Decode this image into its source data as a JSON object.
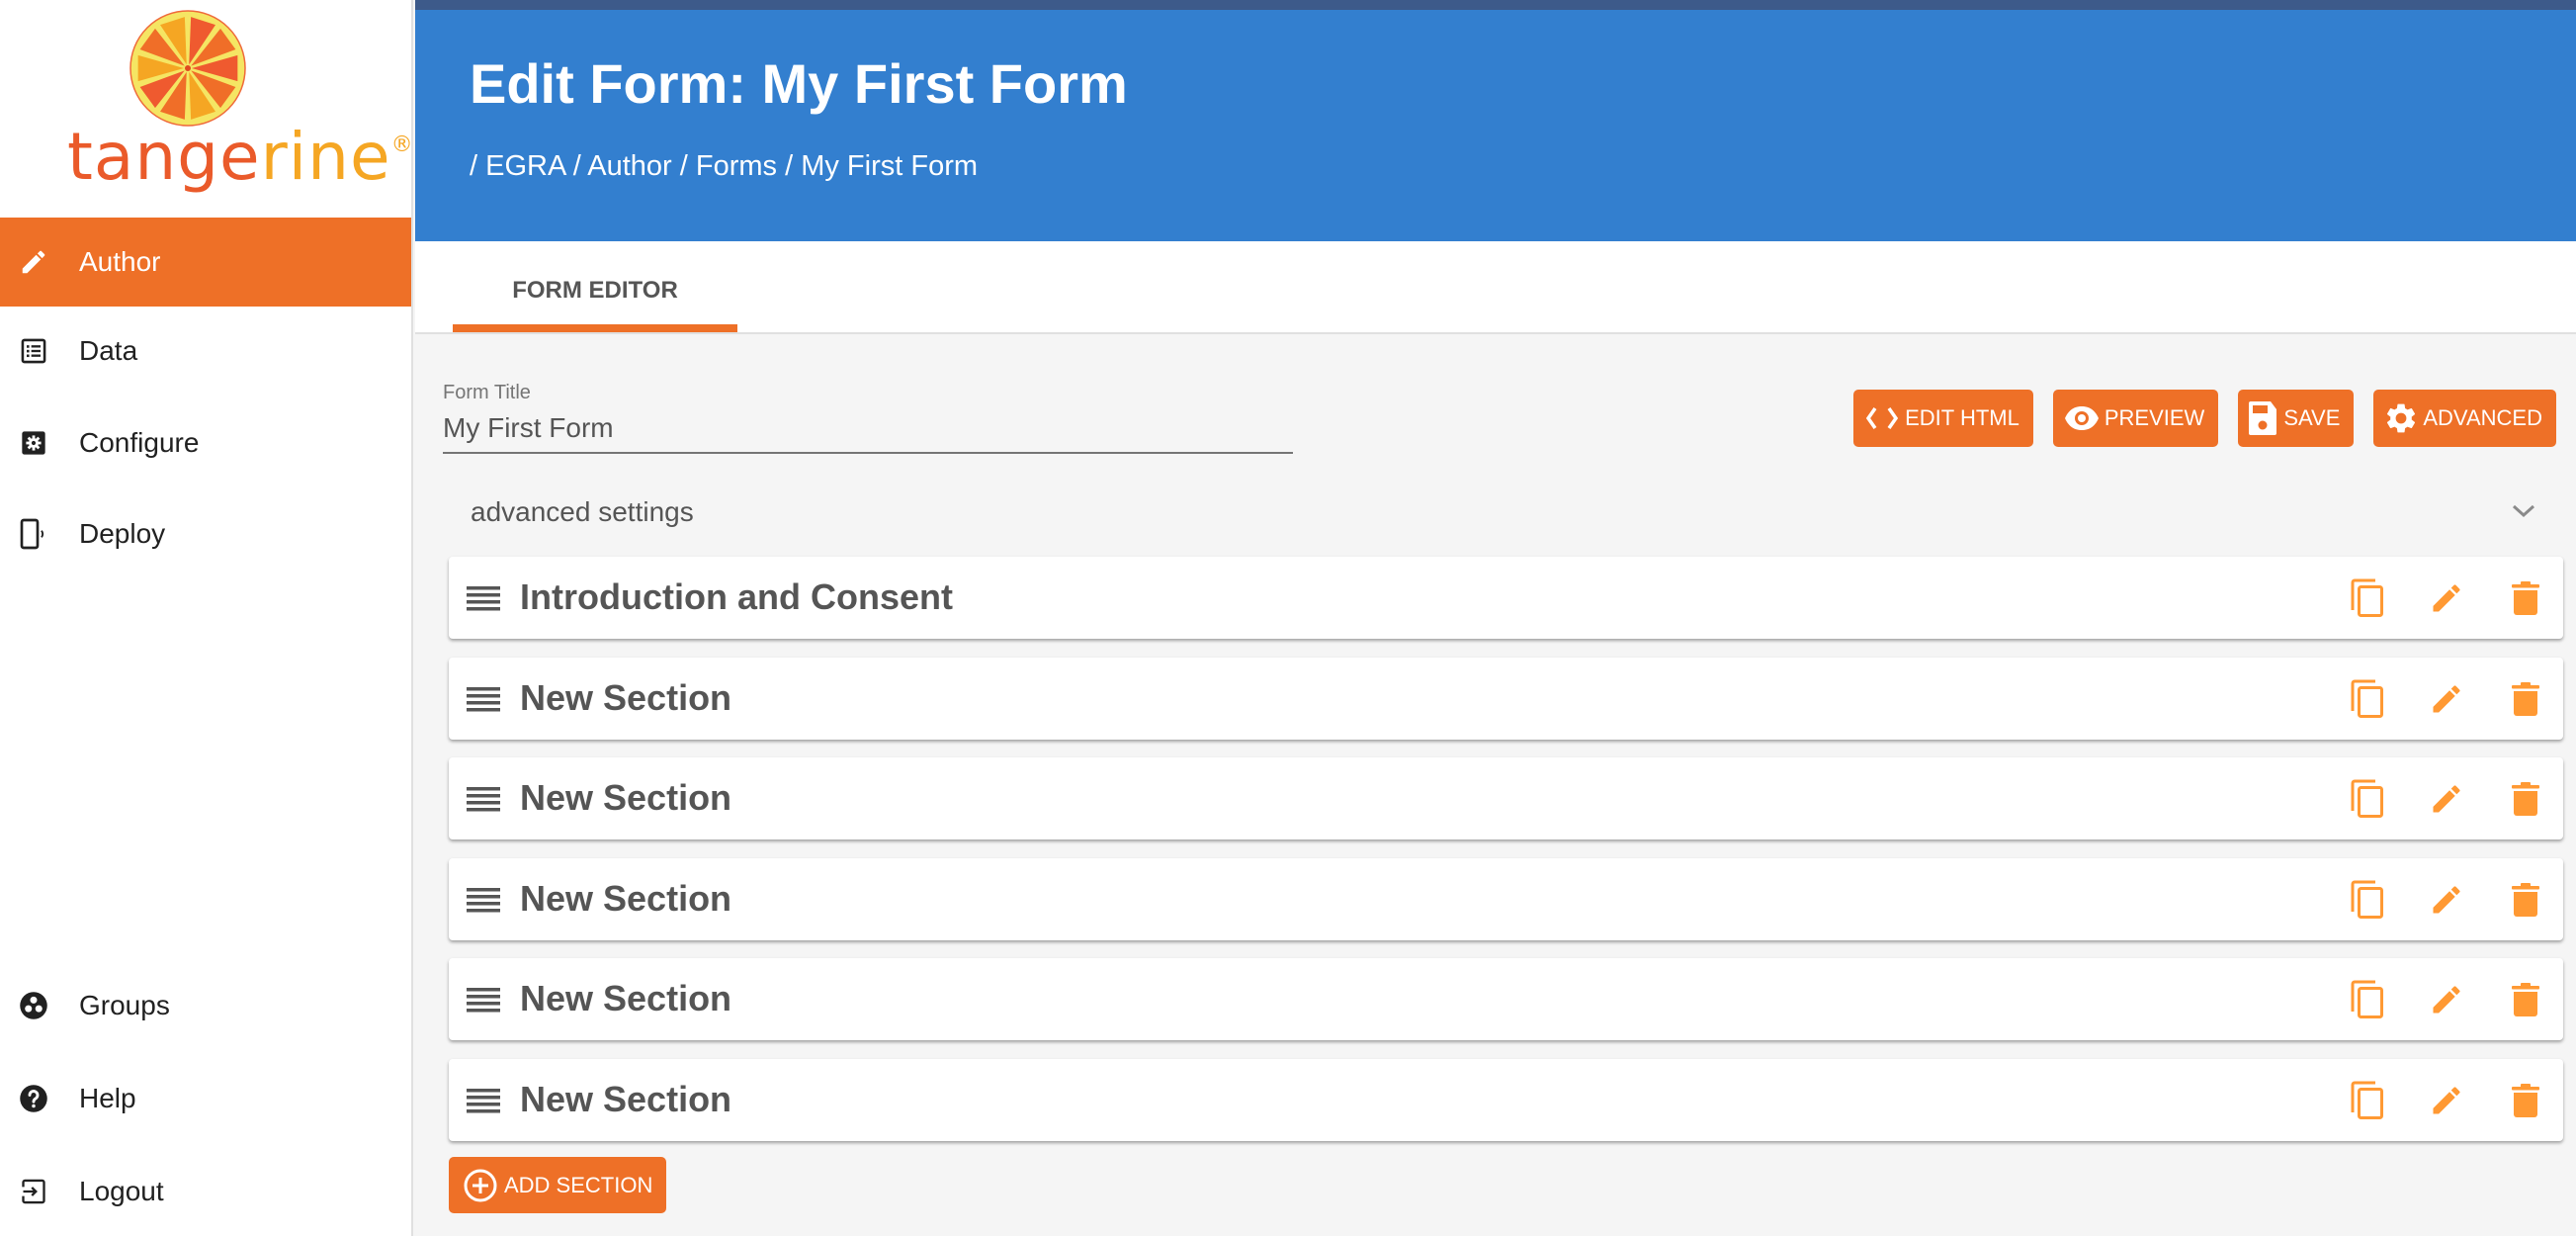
{
  "brand": {
    "logo_text_a": "tange",
    "logo_text_b": "rine",
    "registered": "®",
    "colors": {
      "orange": "#ee7027",
      "action_icon": "#ff9933",
      "header_blue": "#337fcf",
      "top_strip": "#3d5a8a"
    }
  },
  "sidebar": {
    "items": [
      {
        "label": "Author",
        "icon": "pencil-icon",
        "active": true
      },
      {
        "label": "Data",
        "icon": "list-icon",
        "active": false
      },
      {
        "label": "Configure",
        "icon": "gear-box-icon",
        "active": false
      },
      {
        "label": "Deploy",
        "icon": "phone-signal-icon",
        "active": false
      }
    ],
    "bottom_items": [
      {
        "label": "Groups",
        "icon": "groups-icon"
      },
      {
        "label": "Help",
        "icon": "help-icon"
      },
      {
        "label": "Logout",
        "icon": "logout-icon"
      }
    ]
  },
  "header": {
    "title": "Edit Form: My First Form",
    "breadcrumb": "/ EGRA / Author / Forms / My First Form"
  },
  "tabs": [
    {
      "label": "FORM EDITOR",
      "active": true
    }
  ],
  "form": {
    "title_label": "Form Title",
    "title_value": "My First Form"
  },
  "toolbar": {
    "edit_html": "EDIT HTML",
    "preview": "PREVIEW",
    "save": "SAVE",
    "advanced": "ADVANCED"
  },
  "advanced_settings": {
    "label": "advanced settings",
    "expanded": false
  },
  "sections": [
    {
      "title": "Introduction and Consent"
    },
    {
      "title": "New Section"
    },
    {
      "title": "New Section"
    },
    {
      "title": "New Section"
    },
    {
      "title": "New Section"
    },
    {
      "title": "New Section"
    }
  ],
  "add_section_label": "ADD SECTION"
}
